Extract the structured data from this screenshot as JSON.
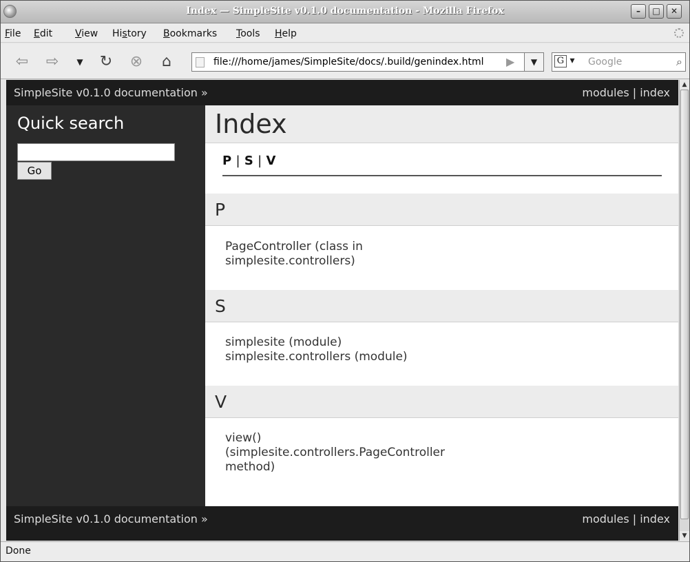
{
  "window": {
    "title": "Index — SimpleSite v0.1.0 documentation - Mozilla Firefox"
  },
  "menubar": {
    "items": [
      {
        "pre": "",
        "key": "F",
        "post": "ile"
      },
      {
        "pre": "",
        "key": "E",
        "post": "dit"
      },
      {
        "pre": "",
        "key": "V",
        "post": "iew"
      },
      {
        "pre": "Hi",
        "key": "s",
        "post": "tory"
      },
      {
        "pre": "",
        "key": "B",
        "post": "ookmarks"
      },
      {
        "pre": "",
        "key": "T",
        "post": "ools"
      },
      {
        "pre": "",
        "key": "H",
        "post": "elp"
      }
    ]
  },
  "navbar": {
    "url": "file:///home/james/SimpleSite/docs/.build/genindex.html",
    "search_placeholder": "Google",
    "search_engine": "G"
  },
  "related": {
    "home": "SimpleSite v0.1.0 documentation »",
    "links": "modules | index"
  },
  "sidebar": {
    "title": "Quick search",
    "go_label": "Go"
  },
  "body": {
    "title": "Index",
    "letters": {
      "p": "P",
      "s": "S",
      "v": "V",
      "sep": "|"
    },
    "sections": {
      "p": {
        "letter": "P",
        "entries": [
          "PageController (class in",
          "simplesite.controllers)"
        ]
      },
      "s": {
        "letter": "S",
        "entries": [
          "simplesite (module)",
          "simplesite.controllers (module)"
        ]
      },
      "v": {
        "letter": "V",
        "entries": [
          "view()",
          "(simplesite.controllers.PageController",
          "method)"
        ]
      }
    }
  },
  "statusbar": {
    "text": "Done"
  }
}
